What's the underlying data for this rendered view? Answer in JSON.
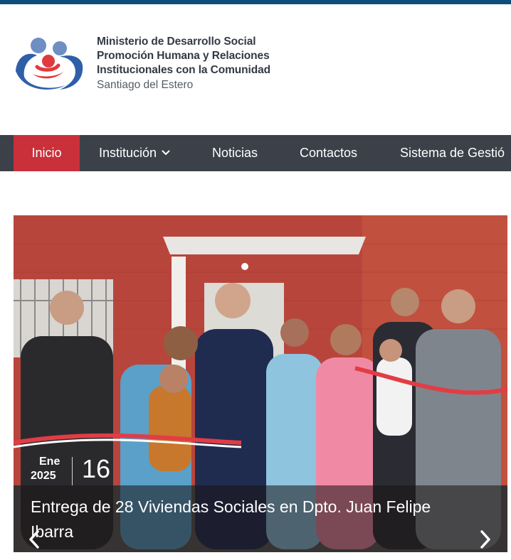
{
  "brand": {
    "line1": "Ministerio de Desarrollo Social",
    "line2": "Promoción Humana y Relaciones",
    "line3": "Institucionales con la Comunidad",
    "line4": "Santiago del Estero"
  },
  "nav": {
    "items": [
      {
        "label": "Inicio"
      },
      {
        "label": "Institución"
      },
      {
        "label": "Noticias"
      },
      {
        "label": "Contactos"
      },
      {
        "label": "Sistema de Gestió"
      }
    ]
  },
  "colors": {
    "topbar": "#0d4f7a",
    "nav_bg": "#3c4049",
    "nav_active": "#c9303a"
  },
  "slide": {
    "date_month": "Ene",
    "date_year": "2025",
    "date_day": "16",
    "caption": "Entrega de 28 Viviendas Sociales en Dpto. Juan Felipe Ibarra"
  },
  "icons": {
    "logo": "family-logo-icon",
    "dropdown": "chevron-down-icon",
    "prev": "chevron-left-icon",
    "next": "chevron-right-icon"
  }
}
